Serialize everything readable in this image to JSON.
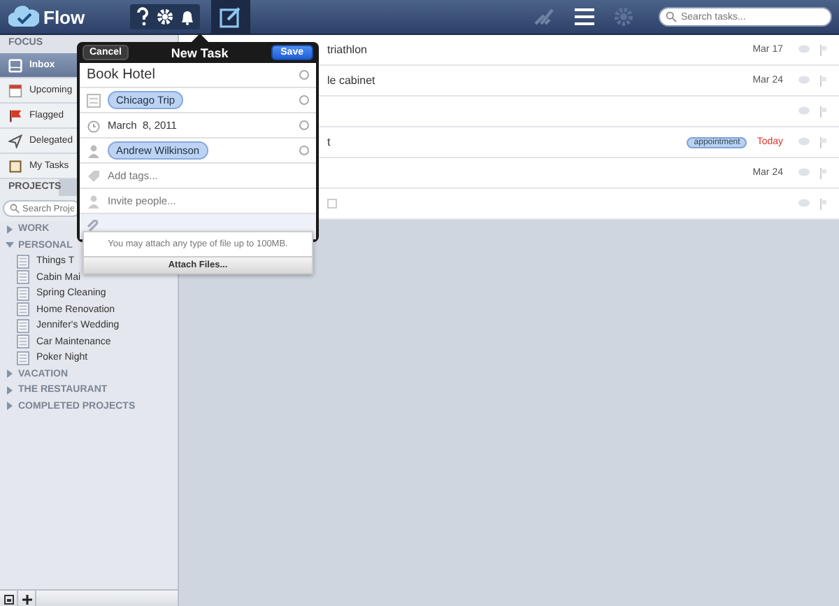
{
  "app": {
    "title": "Flow",
    "compose_selected": true,
    "search_placeholder": "Search tasks..."
  },
  "sidebar": {
    "focus_header": "FOCUS",
    "focus_items": [
      {
        "label": "Inbox",
        "selected": true
      },
      {
        "label": "Upcoming",
        "selected": false
      },
      {
        "label": "Flagged",
        "selected": false
      },
      {
        "label": "Delegated",
        "selected": false
      },
      {
        "label": "My Tasks",
        "selected": false
      }
    ],
    "projects_tab": "PROJECTS",
    "search_placeholder": "Search Proje",
    "groups": [
      {
        "label": "WORK",
        "expanded": false
      },
      {
        "label": "PERSONAL",
        "expanded": true,
        "children": [
          {
            "label": "Things T"
          },
          {
            "label": "Cabin Mai"
          },
          {
            "label": "Spring Cleaning"
          },
          {
            "label": "Home Renovation"
          },
          {
            "label": "Jennifer's Wedding"
          },
          {
            "label": "Car Maintenance"
          },
          {
            "label": "Poker Night"
          }
        ]
      },
      {
        "label": "VACATION",
        "expanded": false
      },
      {
        "label": "THE RESTAURANT",
        "expanded": false
      },
      {
        "label": "COMPLETED PROJECTS",
        "expanded": false
      }
    ]
  },
  "tasks": [
    {
      "title": "triathlon",
      "due": "Mar 17",
      "due_today": false,
      "note": false
    },
    {
      "title": "le cabinet",
      "due": "Mar 24",
      "due_today": false,
      "note": false
    },
    {
      "note": false
    },
    {
      "title": "t",
      "tag": "appointment",
      "due": "Today",
      "due_today": true,
      "note": false
    },
    {
      "due": "Mar 24",
      "due_today": false,
      "note": false
    },
    {
      "note": true
    }
  ],
  "new_task": {
    "title": "New Task",
    "cancel": "Cancel",
    "save": "Save",
    "name": "Book Hotel",
    "project": "Chicago Trip",
    "date": "March  8, 2011",
    "assignee": "Andrew Wilkinson",
    "tags_placeholder": "Add tags...",
    "invite_placeholder": "Invite people...",
    "attach_note": "You may attach any type of file up to 100MB.",
    "attach_button": "Attach Files..."
  }
}
